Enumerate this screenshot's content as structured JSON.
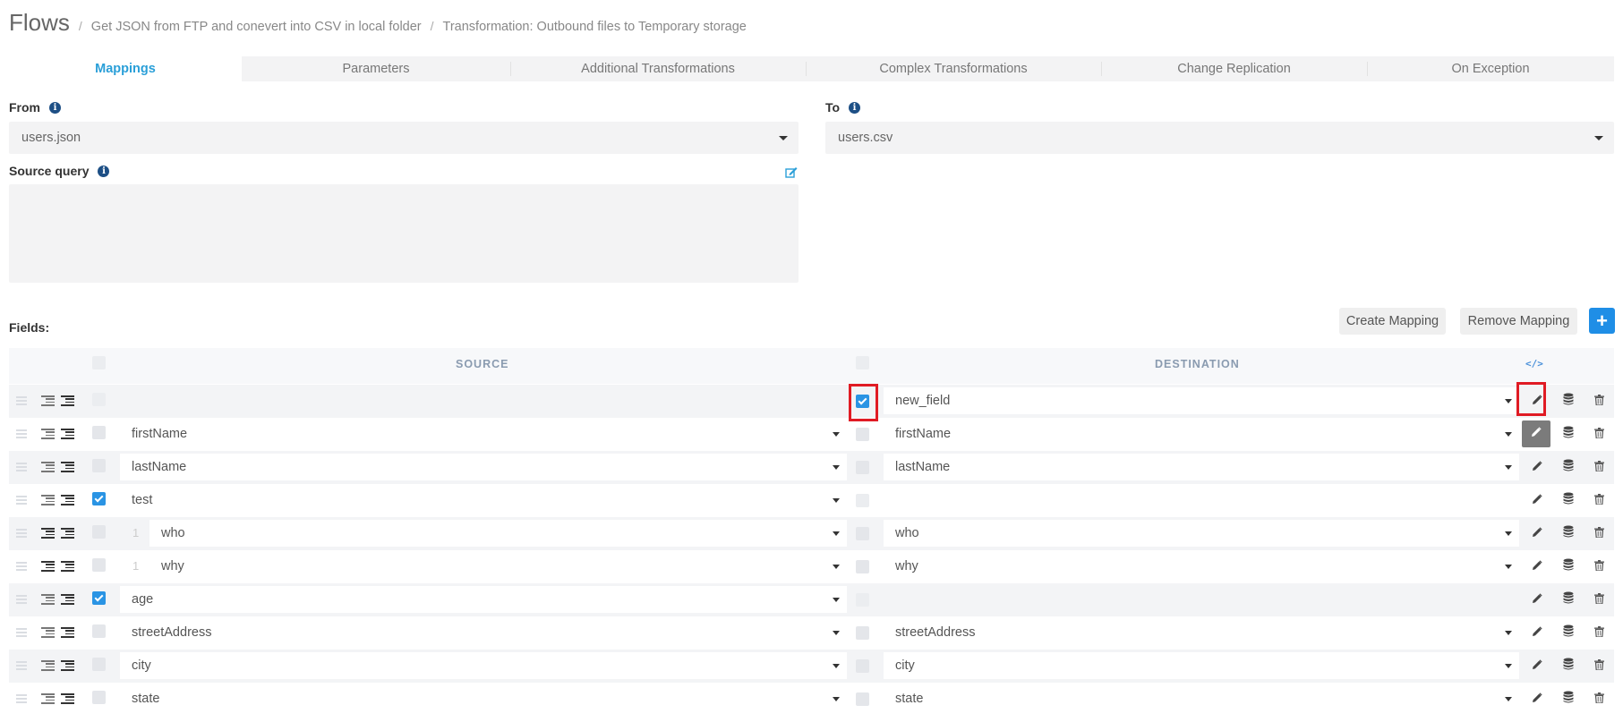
{
  "header": {
    "title": "Flows",
    "breadcrumbs": [
      "Get JSON from FTP and conevert into CSV in local folder",
      "Transformation: Outbound files to Temporary storage"
    ]
  },
  "tabs": [
    {
      "label": "Mappings",
      "active": true
    },
    {
      "label": "Parameters"
    },
    {
      "label": "Additional Transformations"
    },
    {
      "label": "Complex Transformations"
    },
    {
      "label": "Change Replication"
    },
    {
      "label": "On Exception"
    }
  ],
  "from": {
    "label": "From",
    "value": "users.json"
  },
  "to": {
    "label": "To",
    "value": "users.csv"
  },
  "source_query": {
    "label": "Source query",
    "value": ""
  },
  "fields": {
    "label": "Fields:",
    "create_mapping": "Create Mapping",
    "remove_mapping": "Remove Mapping",
    "add_label": "+",
    "source_header": "SOURCE",
    "destination_header": "DESTINATION",
    "code_label": "</>"
  },
  "rows": [
    {
      "source": "",
      "destination": "new_field",
      "src_checked": false,
      "dst_checked": true,
      "level": ""
    },
    {
      "source": "firstName",
      "destination": "firstName",
      "src_checked": false,
      "dst_checked": false,
      "level": ""
    },
    {
      "source": "lastName",
      "destination": "lastName",
      "src_checked": false,
      "dst_checked": false,
      "level": ""
    },
    {
      "source": "test",
      "destination": "",
      "src_checked": true,
      "dst_checked": false,
      "level": ""
    },
    {
      "source": "who",
      "destination": "who",
      "src_checked": false,
      "dst_checked": false,
      "level": "1"
    },
    {
      "source": "why",
      "destination": "why",
      "src_checked": false,
      "dst_checked": false,
      "level": "1"
    },
    {
      "source": "age",
      "destination": "",
      "src_checked": true,
      "dst_checked": false,
      "level": ""
    },
    {
      "source": "streetAddress",
      "destination": "streetAddress",
      "src_checked": false,
      "dst_checked": false,
      "level": ""
    },
    {
      "source": "city",
      "destination": "city",
      "src_checked": false,
      "dst_checked": false,
      "level": ""
    },
    {
      "source": "state",
      "destination": "state",
      "src_checked": false,
      "dst_checked": false,
      "level": ""
    }
  ],
  "colors": {
    "accent": "#2a9fd8",
    "primary_button": "#1f8ee6",
    "highlight": "#e01b24"
  }
}
